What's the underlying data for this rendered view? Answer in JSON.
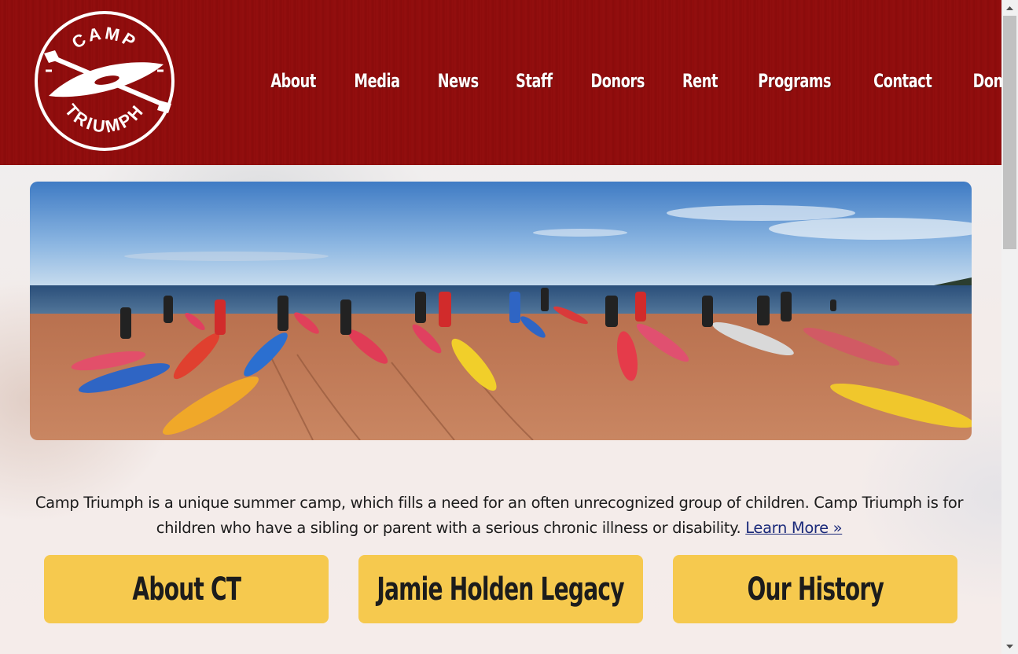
{
  "site": {
    "logo_text_top": "CAMP",
    "logo_text_bottom": "TRIUMPH",
    "brand_color": "#8e0c0c",
    "accent_color": "#f6c94e"
  },
  "nav": {
    "items": [
      {
        "label": "About"
      },
      {
        "label": "Media"
      },
      {
        "label": "News"
      },
      {
        "label": "Staff"
      },
      {
        "label": "Donors"
      },
      {
        "label": "Rent"
      },
      {
        "label": "Programs"
      },
      {
        "label": "Contact"
      },
      {
        "label": "Donate"
      }
    ]
  },
  "intro": {
    "text": "Camp Triumph is a unique summer camp, which fills a need for an often unrecognized group of children. Camp Triumph is for children who have a sibling or parent with a serious chronic illness or disability.",
    "link_label": "Learn More »"
  },
  "cards": [
    {
      "label": "About CT"
    },
    {
      "label": "Jamie Holden Legacy"
    },
    {
      "label": "Our History"
    }
  ]
}
